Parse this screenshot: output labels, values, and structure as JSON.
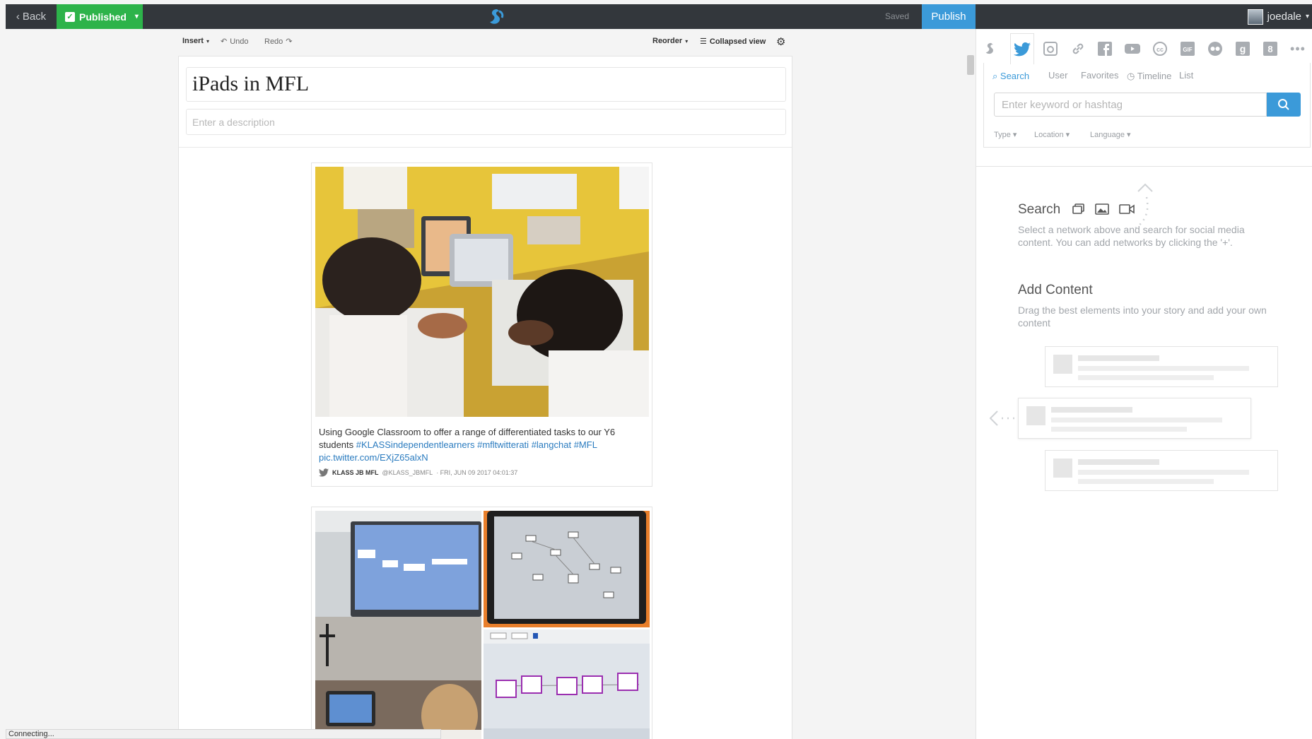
{
  "topbar": {
    "back_label": "Back",
    "published_label": "Published",
    "saved_label": "Saved",
    "publish_label": "Publish",
    "username": "joedale"
  },
  "toolbar": {
    "insert_label": "Insert",
    "undo_label": "Undo",
    "redo_label": "Redo",
    "reorder_label": "Reorder",
    "collapsed_view_label": "Collapsed view"
  },
  "story": {
    "title": "iPads in MFL",
    "description_placeholder": "Enter a description"
  },
  "tweet": {
    "text_plain": "Using Google Classroom to offer a range of differentiated tasks to our Y6 students",
    "hashtags": [
      "#KLASSindependentlearners",
      "#mfltwitterati",
      "#langchat",
      "#MFL"
    ],
    "link": "pic.twitter.com/EXjZ65alxN",
    "author_name": "KLASS JB MFL",
    "author_handle": "@KLASS_JBMFL",
    "timestamp": "· FRI, JUN 09 2017 04:01:37"
  },
  "status_bar": "Connecting...",
  "panel": {
    "networks": [
      "storify-icon",
      "twitter-icon",
      "instagram-icon",
      "link-icon",
      "facebook-icon",
      "youtube-icon",
      "creative-commons-icon",
      "gif-icon",
      "flickr-icon",
      "google-icon",
      "google-plus-icon",
      "more-icon"
    ],
    "subtabs": [
      "Search",
      "User",
      "Favorites",
      "Timeline",
      "List"
    ],
    "search_placeholder": "Enter keyword or hashtag",
    "filters": [
      "Type",
      "Location",
      "Language"
    ],
    "help_search_title": "Search",
    "help_search_text": "Select a network above and search for social media content. You can add networks by clicking the '+'.",
    "help_add_title": "Add Content",
    "help_add_text": "Drag the best elements into your story and add your own content"
  },
  "colors": {
    "accent": "#3b9ad9",
    "published": "#2db34a",
    "topbar": "#33373c",
    "link": "#2a7bbf"
  }
}
